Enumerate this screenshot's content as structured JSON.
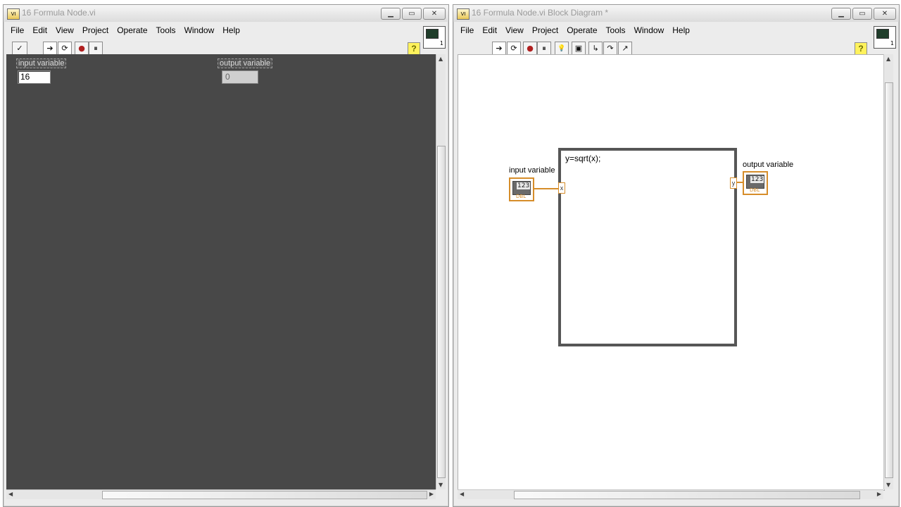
{
  "front_panel": {
    "title": "16 Formula Node.vi",
    "menus": [
      "File",
      "Edit",
      "View",
      "Project",
      "Operate",
      "Tools",
      "Window",
      "Help"
    ],
    "toolbar": {
      "ok_glyph": "✓",
      "run_glyph": "➔",
      "run_cont_glyph": "⟳",
      "abort_glyph": "●",
      "pause_glyph": "⏸",
      "help_glyph": "?"
    },
    "input_control": {
      "label": "input variable",
      "value": "16"
    },
    "output_indicator": {
      "label": "output variable",
      "value": "0"
    }
  },
  "block_diagram": {
    "title": "16 Formula Node.vi Block Diagram *",
    "menus": [
      "File",
      "Edit",
      "View",
      "Project",
      "Operate",
      "Tools",
      "Window",
      "Help"
    ],
    "toolbar": {
      "run_glyph": "➔",
      "run_cont_glyph": "⟳",
      "abort_glyph": "●",
      "pause_glyph": "⏸",
      "highlight_glyph": "💡",
      "retain_glyph": "▣",
      "step_into_glyph": "↳",
      "step_over_glyph": "↷",
      "step_out_glyph": "↗",
      "help_glyph": "?"
    },
    "formula": "y=sqrt(x);",
    "input_terminal": {
      "label": "input variable",
      "num": "123",
      "type": "DBL"
    },
    "output_terminal": {
      "label": "output variable",
      "num": "123",
      "type": "DBL"
    },
    "node_input": "x",
    "node_output": "y"
  },
  "window_buttons": {
    "minimize": "▁",
    "maximize": "▭",
    "close": "✕"
  },
  "vi_icon_connector": "1",
  "colors": {
    "panel_bg": "#484848",
    "wire_orange": "#d68d2a",
    "diagram_bg": "#ffffff"
  }
}
